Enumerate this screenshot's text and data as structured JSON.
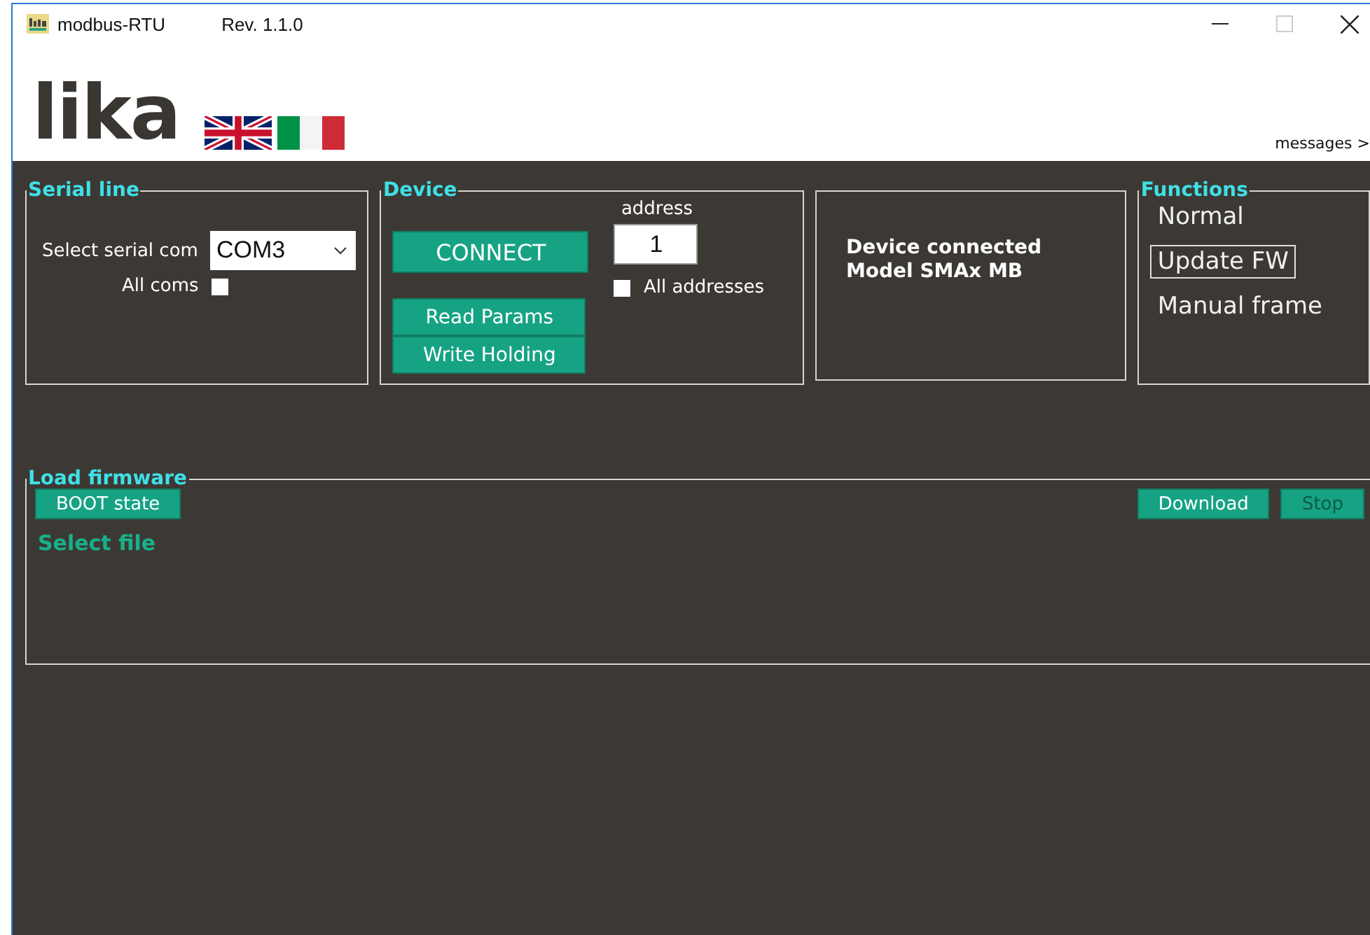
{
  "window": {
    "title": "modbus-RTU",
    "revision": "Rev. 1.1.0"
  },
  "header": {
    "logo": "lika",
    "messages_link": "messages >"
  },
  "serial_line": {
    "title": "Serial line",
    "select_label": "Select serial com",
    "port": "COM3",
    "all_coms": {
      "label": "All coms",
      "checked": false
    }
  },
  "device": {
    "title": "Device",
    "connect": "CONNECT",
    "address_label": "address",
    "address": "1",
    "all_addresses": {
      "label": "All addresses",
      "checked": false
    },
    "buttons": [
      {
        "label": "Read Params"
      },
      {
        "label": "Write Holding"
      }
    ]
  },
  "status": [
    "Device connected",
    "Model  SMAx MB"
  ],
  "functions": {
    "title": "Functions",
    "items": [
      {
        "label": "Normal",
        "selected": false
      },
      {
        "label": "Update FW",
        "selected": true
      },
      {
        "label": "Manual frame",
        "selected": false
      }
    ]
  },
  "load_firmware": {
    "title": "Load firmware",
    "boot_button": "BOOT state",
    "select_file": "Select file",
    "buttons": [
      {
        "label": "Download",
        "disabled": false
      },
      {
        "label": "Stop",
        "disabled": true
      }
    ]
  }
}
